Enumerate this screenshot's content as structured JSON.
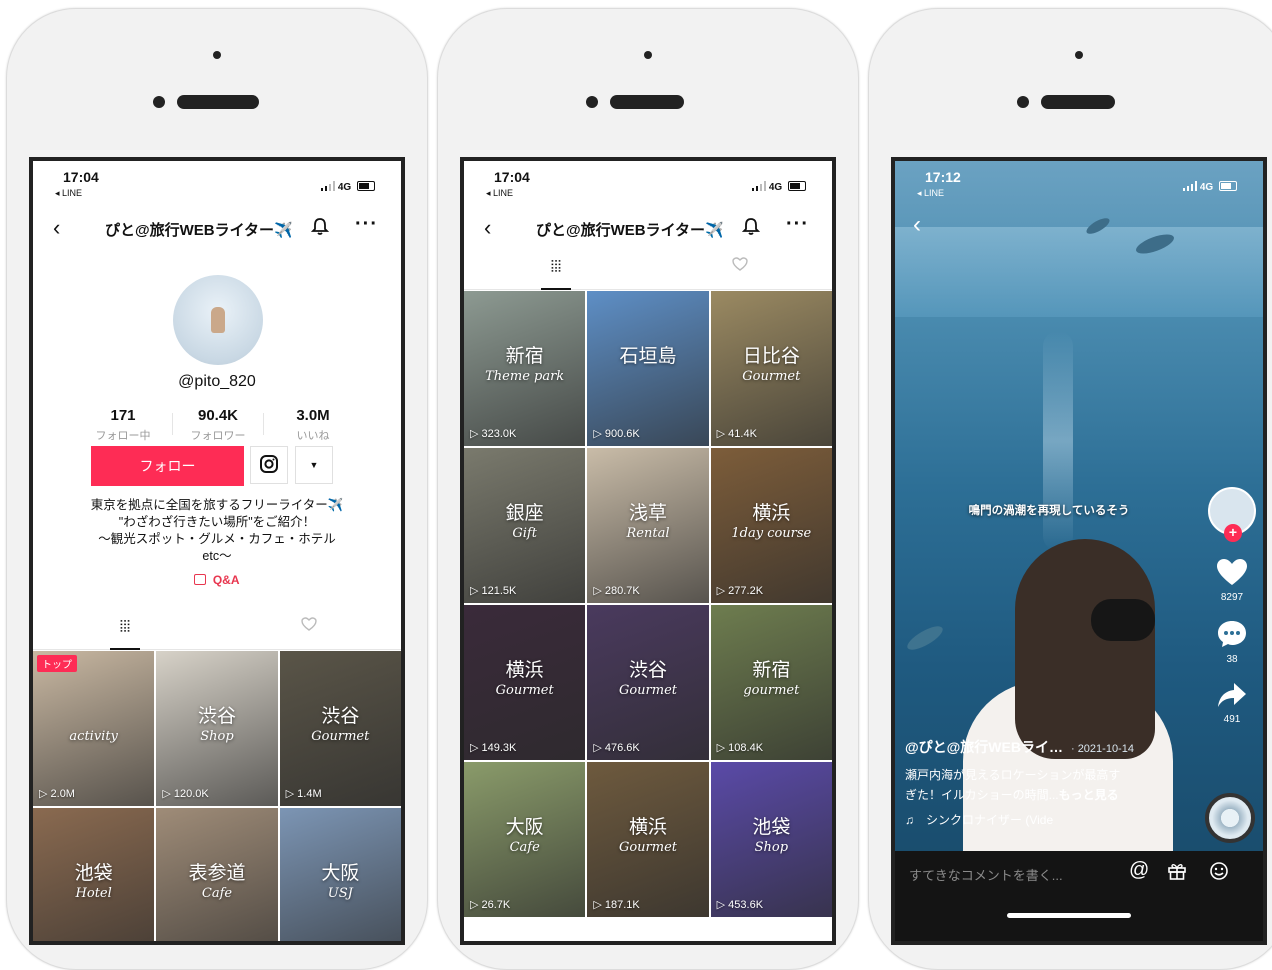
{
  "status": {
    "time_1": "17:04",
    "time_2": "17:04",
    "time_3": "17:12",
    "back_app": "◂ LINE",
    "network": "4G"
  },
  "profile": {
    "title": "ぴと@旅行WEBライター✈️",
    "handle": "@pito_820",
    "stats": [
      {
        "value": "171",
        "label": "フォロー中"
      },
      {
        "value": "90.4K",
        "label": "フォロワー"
      },
      {
        "value": "3.0M",
        "label": "いいね"
      }
    ],
    "follow_label": "フォロー",
    "dropdown_symbol": "▼",
    "bio_lines": [
      "東京を拠点に全国を旅するフリーライター✈️",
      "\"わざわざ行きたい場所\"をご紹介！",
      "〜観光スポット・グルメ・カフェ・ホテル",
      "etc〜"
    ],
    "qa_label": "Q&A",
    "grid_tab_symbol": "⦙⦙⦙",
    "top_badge": "トップ"
  },
  "phone1_videos": [
    {
      "place": "",
      "sub": "activity",
      "views": "2.0M",
      "color": "#c9b8a2"
    },
    {
      "place": "渋谷",
      "sub": "Shop",
      "views": "120.0K",
      "color": "#d7d2c8"
    },
    {
      "place": "渋谷",
      "sub": "Gourmet",
      "views": "1.4M",
      "color": "#5a5548"
    },
    {
      "place": "池袋",
      "sub": "Hotel",
      "views": "",
      "color": "#8a6a50"
    },
    {
      "place": "表参道",
      "sub": "Cafe",
      "views": "",
      "color": "#9f8c78"
    },
    {
      "place": "大阪",
      "sub": "USJ",
      "views": "",
      "color": "#7c95b4"
    }
  ],
  "phone2_videos": [
    {
      "place": "新宿",
      "sub": "Theme park",
      "views": "323.0K",
      "color": "#8d9a92"
    },
    {
      "place": "石垣島",
      "sub": "",
      "views": "900.6K",
      "color": "#5e8fc6"
    },
    {
      "place": "日比谷",
      "sub": "Gourmet",
      "views": "41.4K",
      "color": "#9b8a62"
    },
    {
      "place": "銀座",
      "sub": "Gift",
      "views": "121.5K",
      "color": "#7a7a6d"
    },
    {
      "place": "浅草",
      "sub": "Rental",
      "views": "280.7K",
      "color": "#c9bca8"
    },
    {
      "place": "横浜",
      "sub": "1day course",
      "views": "277.2K",
      "color": "#7d5d3a"
    },
    {
      "place": "横浜",
      "sub": "Gourmet",
      "views": "149.3K",
      "color": "#3a2a3a"
    },
    {
      "place": "渋谷",
      "sub": "Gourmet",
      "views": "476.6K",
      "color": "#4a3a5e"
    },
    {
      "place": "新宿",
      "sub": "gourmet",
      "views": "108.4K",
      "color": "#6e7d4f"
    },
    {
      "place": "大阪",
      "sub": "Cafe",
      "views": "26.7K",
      "color": "#8a9b6a"
    },
    {
      "place": "横浜",
      "sub": "Gourmet",
      "views": "187.1K",
      "color": "#6e5a3e"
    },
    {
      "place": "池袋",
      "sub": "Shop",
      "views": "453.6K",
      "color": "#5a4aa8"
    }
  ],
  "video_player": {
    "overlay_caption": "鳴門の渦潮を再現しているそう",
    "likes": "8297",
    "comments": "38",
    "shares": "491",
    "user": "@ぴと@旅行WEBライ…",
    "date": "· 2021-10-14",
    "desc_line1": "瀬戸内海が見えるロケーションが最高す",
    "desc_line2": "ぎた！イルカショーの時間...",
    "more": "もっと見る",
    "music": "♫　シンクロナイザー (Vide",
    "comment_placeholder": "すてきなコメントを書く...",
    "icons": [
      "at-icon",
      "gift-icon",
      "emoji-icon"
    ]
  },
  "colors": {
    "accent": "#fe2c55",
    "qa": "#e8364f",
    "frame": "#f2f2f2"
  }
}
